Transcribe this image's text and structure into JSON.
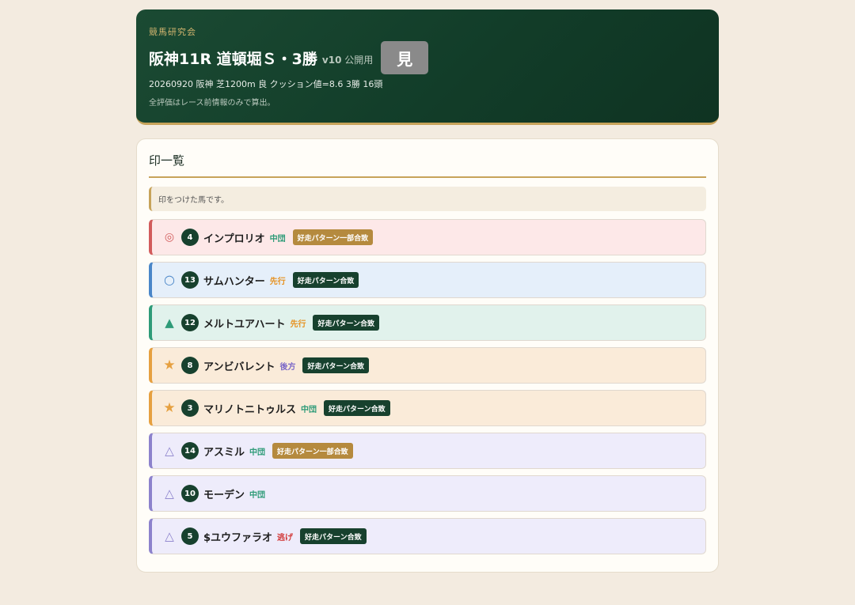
{
  "header": {
    "org": "競馬研究会",
    "title": "阪神11R 道頓堀Ｓ・3勝",
    "version": "v10",
    "audience": "公開用",
    "status_badge": "見",
    "meta": "20260920 阪神 芝1200m 良 クッション値=8.6 3勝 16頭",
    "note": "全評価はレース前情報のみで算出。"
  },
  "panel": {
    "title": "印一覧",
    "info": "印をつけた馬です。"
  },
  "colors": {
    "style_front": "#e6911f",
    "style_mid": "#2e9b78",
    "style_rear": "#7b68c8",
    "style_lead": "#d23c3c",
    "tag_partial": "#b58a3e",
    "tag_match": "#17412e"
  },
  "horses": [
    {
      "mark": "◎",
      "mark_type": "double-circle",
      "cls": "m-double",
      "number": "4",
      "name": "インプロリオ",
      "style": "中団",
      "style_color": "#2e9b78",
      "tag": "好走パターン一部合致",
      "tag_color": "#b58a3e"
    },
    {
      "mark": "○",
      "mark_type": "circle",
      "cls": "m-circle",
      "number": "13",
      "name": "サムハンター",
      "style": "先行",
      "style_color": "#e6911f",
      "tag": "好走パターン合致",
      "tag_color": "#17412e"
    },
    {
      "mark": "▲",
      "mark_type": "filled-triangle",
      "cls": "m-tri",
      "number": "12",
      "name": "メルトユアハート",
      "style": "先行",
      "style_color": "#e6911f",
      "tag": "好走パターン合致",
      "tag_color": "#17412e"
    },
    {
      "mark": "★",
      "mark_type": "star",
      "cls": "m-star",
      "number": "8",
      "name": "アンビバレント",
      "style": "後方",
      "style_color": "#7b68c8",
      "tag": "好走パターン合致",
      "tag_color": "#17412e"
    },
    {
      "mark": "★",
      "mark_type": "star",
      "cls": "m-star",
      "number": "3",
      "name": "マリノトニトゥルス",
      "style": "中団",
      "style_color": "#2e9b78",
      "tag": "好走パターン合致",
      "tag_color": "#17412e"
    },
    {
      "mark": "△",
      "mark_type": "triangle",
      "cls": "m-delta",
      "number": "14",
      "name": "アスミル",
      "style": "中団",
      "style_color": "#2e9b78",
      "tag": "好走パターン一部合致",
      "tag_color": "#b58a3e"
    },
    {
      "mark": "△",
      "mark_type": "triangle",
      "cls": "m-delta",
      "number": "10",
      "name": "モーデン",
      "style": "中団",
      "style_color": "#2e9b78",
      "tag": "",
      "tag_color": ""
    },
    {
      "mark": "△",
      "mark_type": "triangle",
      "cls": "m-delta",
      "number": "5",
      "name": "$ユウファラオ",
      "style": "逃げ",
      "style_color": "#d23c3c",
      "tag": "好走パターン合致",
      "tag_color": "#17412e"
    }
  ]
}
